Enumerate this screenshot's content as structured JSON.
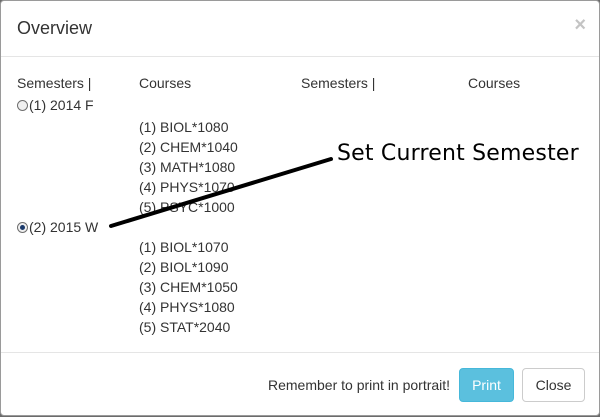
{
  "modal": {
    "title": "Overview",
    "close_glyph": "×"
  },
  "columns": {
    "left_semesters": "Semesters |",
    "left_courses": "Courses",
    "right_semesters": "Semesters |",
    "right_courses": "Courses"
  },
  "semesters": [
    {
      "label": "(1) 2014 F",
      "selected": false,
      "courses": [
        "(1) BIOL*1080",
        "(2) CHEM*1040",
        "(3) MATH*1080",
        "(4) PHYS*1070",
        "(5) PSYC*1000"
      ]
    },
    {
      "label": "(2) 2015 W",
      "selected": true,
      "courses": [
        "(1) BIOL*1070",
        "(2) BIOL*1090",
        "(3) CHEM*1050",
        "(4) PHYS*1080",
        "(5) STAT*2040"
      ]
    }
  ],
  "annotation": {
    "text": "Set Current Semester"
  },
  "footer": {
    "note": "Remember to print in portrait!",
    "print_label": "Print",
    "close_label": "Close"
  },
  "colors": {
    "print_button": "#5bc0de",
    "radio_checked": "#1b3a6b"
  },
  "icons": {
    "close": "close-icon",
    "radio": "radio-icon"
  }
}
